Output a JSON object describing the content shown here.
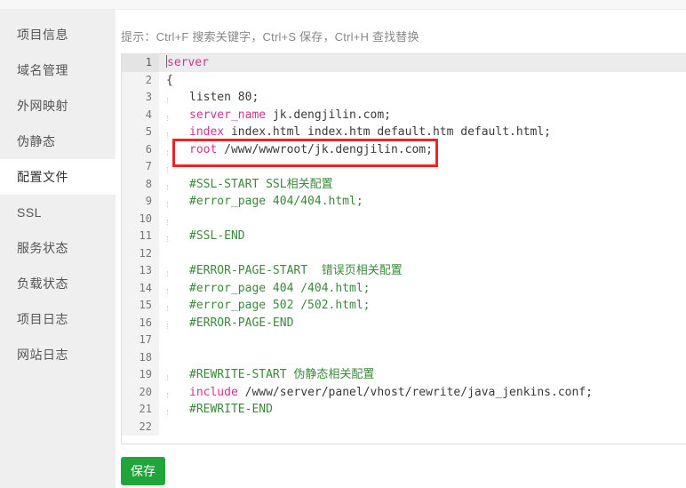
{
  "sidebar": {
    "items": [
      {
        "label": "项目信息",
        "active": false
      },
      {
        "label": "域名管理",
        "active": false
      },
      {
        "label": "外网映射",
        "active": false
      },
      {
        "label": "伪静态",
        "active": false
      },
      {
        "label": "配置文件",
        "active": true
      },
      {
        "label": "SSL",
        "active": false
      },
      {
        "label": "服务状态",
        "active": false
      },
      {
        "label": "负载状态",
        "active": false
      },
      {
        "label": "项目日志",
        "active": false
      },
      {
        "label": "网站日志",
        "active": false
      }
    ]
  },
  "main": {
    "hint": "提示：Ctrl+F 搜索关键字，Ctrl+S 保存，Ctrl+H 查找替换",
    "save_label": "保存",
    "accent_green": "#20a53a",
    "highlight_red": "#f02424",
    "keyword_color": "#d6338f",
    "comment_color": "#3a8a3a"
  },
  "editor": {
    "active_line": 1,
    "total_lines": 22,
    "lines": [
      {
        "n": "1",
        "indent": 0,
        "parts": [
          {
            "t": "kw",
            "s": "server"
          }
        ]
      },
      {
        "n": "2",
        "indent": 0,
        "parts": [
          {
            "t": "txt",
            "s": "{"
          }
        ]
      },
      {
        "n": "3",
        "indent": 1,
        "parts": [
          {
            "t": "txt",
            "s": "listen 80;"
          }
        ]
      },
      {
        "n": "4",
        "indent": 1,
        "parts": [
          {
            "t": "kw",
            "s": "server_name"
          },
          {
            "t": "txt",
            "s": " jk.dengjilin.com;"
          }
        ]
      },
      {
        "n": "5",
        "indent": 1,
        "parts": [
          {
            "t": "kw",
            "s": "index"
          },
          {
            "t": "txt",
            "s": " index.html index.htm default.htm default.html;"
          }
        ]
      },
      {
        "n": "6",
        "indent": 1,
        "parts": [
          {
            "t": "kw",
            "s": "root"
          },
          {
            "t": "txt",
            "s": " /www/wwwroot/jk.dengjilin.com;"
          }
        ]
      },
      {
        "n": "7",
        "indent": 1,
        "parts": []
      },
      {
        "n": "8",
        "indent": 1,
        "parts": [
          {
            "t": "cm",
            "s": "#SSL-START SSL相关配置"
          }
        ]
      },
      {
        "n": "9",
        "indent": 1,
        "parts": [
          {
            "t": "cm",
            "s": "#error_page 404/404.html;"
          }
        ]
      },
      {
        "n": "10",
        "indent": 1,
        "parts": []
      },
      {
        "n": "11",
        "indent": 1,
        "parts": [
          {
            "t": "cm",
            "s": "#SSL-END"
          }
        ]
      },
      {
        "n": "12",
        "indent": 0,
        "parts": []
      },
      {
        "n": "13",
        "indent": 1,
        "parts": [
          {
            "t": "cm",
            "s": "#ERROR-PAGE-START  错误页相关配置"
          }
        ]
      },
      {
        "n": "14",
        "indent": 1,
        "parts": [
          {
            "t": "cm",
            "s": "#error_page 404 /404.html;"
          }
        ]
      },
      {
        "n": "15",
        "indent": 1,
        "parts": [
          {
            "t": "cm",
            "s": "#error_page 502 /502.html;"
          }
        ]
      },
      {
        "n": "16",
        "indent": 1,
        "parts": [
          {
            "t": "cm",
            "s": "#ERROR-PAGE-END"
          }
        ]
      },
      {
        "n": "17",
        "indent": 0,
        "parts": []
      },
      {
        "n": "18",
        "indent": 0,
        "parts": []
      },
      {
        "n": "19",
        "indent": 1,
        "parts": [
          {
            "t": "cm",
            "s": "#REWRITE-START 伪静态相关配置"
          }
        ]
      },
      {
        "n": "20",
        "indent": 1,
        "parts": [
          {
            "t": "kw",
            "s": "include"
          },
          {
            "t": "txt",
            "s": " /www/server/panel/vhost/rewrite/java_jenkins.conf;"
          }
        ]
      },
      {
        "n": "21",
        "indent": 1,
        "parts": [
          {
            "t": "cm",
            "s": "#REWRITE-END"
          }
        ]
      },
      {
        "n": "22",
        "indent": 0,
        "parts": []
      }
    ],
    "annotation": {
      "line": 6,
      "label": "root-directive-highlight"
    }
  }
}
